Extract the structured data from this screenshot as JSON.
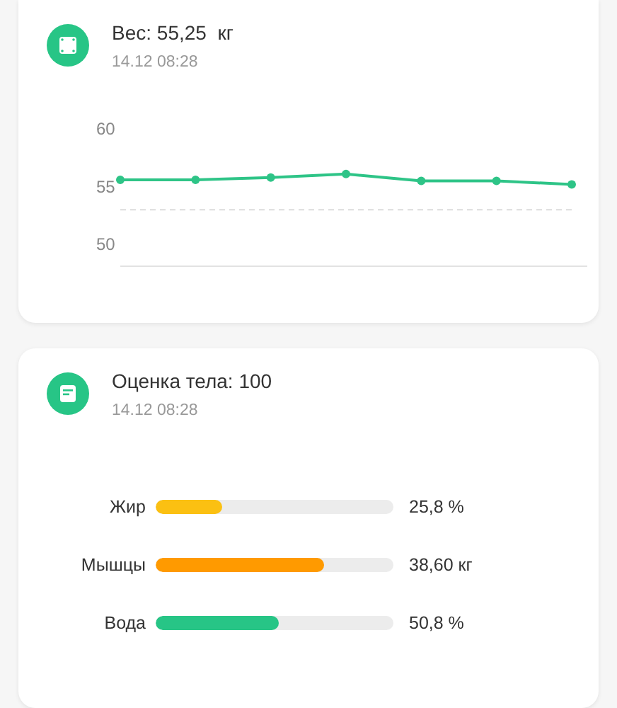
{
  "weight_card": {
    "title": "Вес: 55,25  кг",
    "date": "14.12 08:28",
    "chart_data": {
      "type": "line",
      "ylim": [
        48.2,
        60
      ],
      "yticks": [
        50,
        55,
        60
      ],
      "series": [
        {
          "color": "#2ec487",
          "marker": "circle",
          "values": [
            55.7,
            55.7,
            55.9,
            56.2,
            55.6,
            55.6,
            55.3
          ]
        }
      ],
      "ref_lines": [
        {
          "axis": "y",
          "value": 53.1
        }
      ]
    }
  },
  "body_card": {
    "title": "Оценка тела: 100",
    "date": "14.12 08:28",
    "metrics": [
      {
        "label": "Жир",
        "level": 0.28,
        "color": "#fbc012",
        "reading": "25,8 %"
      },
      {
        "label": "Мышцы",
        "level": 0.71,
        "color": "#ff9a00",
        "reading": "38,60 кг"
      },
      {
        "label": "Вода",
        "level": 0.52,
        "color": "#27c586",
        "reading": "50,8 %"
      }
    ]
  }
}
